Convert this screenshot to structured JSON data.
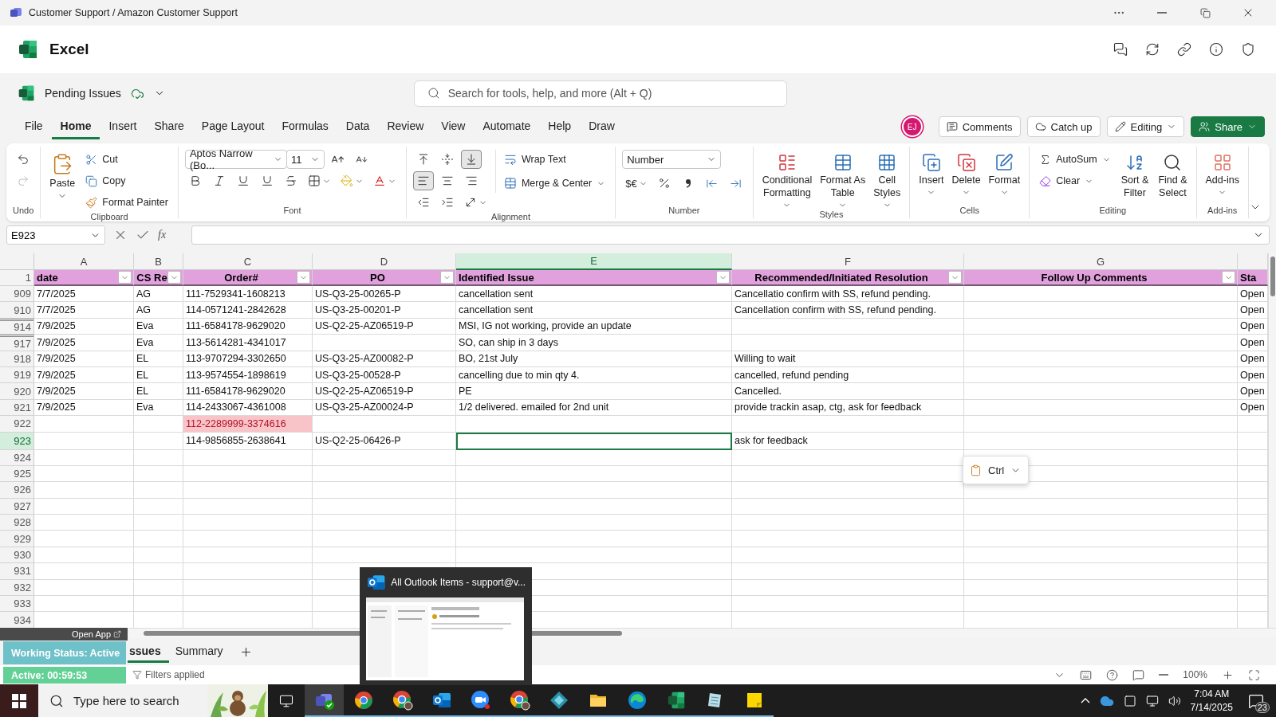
{
  "window": {
    "title": "Customer Support / Amazon Customer Support"
  },
  "app": {
    "name": "Excel"
  },
  "document": {
    "name": "Pending Issues",
    "saved": true
  },
  "search": {
    "placeholder": "Search for tools, help, and more (Alt + Q)"
  },
  "menu_tabs": [
    {
      "label": "File",
      "selected": false
    },
    {
      "label": "Home",
      "selected": true
    },
    {
      "label": "Insert",
      "selected": false
    },
    {
      "label": "Share",
      "selected": false
    },
    {
      "label": "Page Layout",
      "selected": false
    },
    {
      "label": "Formulas",
      "selected": false
    },
    {
      "label": "Data",
      "selected": false
    },
    {
      "label": "Review",
      "selected": false
    },
    {
      "label": "View",
      "selected": false
    },
    {
      "label": "Automate",
      "selected": false
    },
    {
      "label": "Help",
      "selected": false
    },
    {
      "label": "Draw",
      "selected": false
    }
  ],
  "user": {
    "initials": "EJ"
  },
  "header_buttons": [
    {
      "label": "Comments",
      "kind": "comments"
    },
    {
      "label": "Catch up",
      "kind": "catchup"
    },
    {
      "label": "Editing",
      "kind": "editing"
    },
    {
      "label": "Share",
      "kind": "share"
    }
  ],
  "ribbon": {
    "groups": [
      {
        "kind": "undo",
        "label": "Undo",
        "items": [
          {
            "disabled": false
          },
          {
            "disabled": true
          }
        ]
      },
      {
        "kind": "clipboard",
        "label": "Clipboard",
        "items": [
          {
            "label": "Paste"
          },
          {
            "label": "Cut"
          },
          {
            "label": "Copy"
          },
          {
            "label": "Format Painter"
          }
        ]
      },
      {
        "kind": "font",
        "label": "Font",
        "font_name": "Aptos Narrow (Bo...",
        "font_size": "11"
      },
      {
        "kind": "alignment",
        "label": "Alignment",
        "items": [
          {
            "selected": false
          },
          {
            "selected": false
          },
          {
            "selected": true
          },
          {
            "selected": true
          },
          {
            "selected": false
          },
          {
            "selected": false
          },
          {
            "selected": false
          },
          {
            "selected": false
          },
          {
            "selected": false
          },
          {
            "label": "Wrap Text"
          },
          {
            "label": "Merge & Center"
          }
        ]
      },
      {
        "kind": "number",
        "label": "Number",
        "format": "Number",
        "currency": "$€"
      },
      {
        "kind": "styles",
        "label": "Styles",
        "items": [
          {
            "lines": [
              "Conditional",
              "Formatting"
            ]
          },
          {
            "lines": [
              "Format As",
              "Table"
            ]
          },
          {
            "lines": [
              "Cell",
              "Styles"
            ]
          }
        ]
      },
      {
        "kind": "cells",
        "label": "Cells",
        "items": [
          {
            "lines": [
              "Insert"
            ]
          },
          {
            "lines": [
              "Delete"
            ]
          },
          {
            "lines": [
              "Format"
            ]
          }
        ]
      },
      {
        "kind": "editing",
        "label": "Editing",
        "items": [
          {
            "lines": [
              "AutoSum"
            ]
          },
          {
            "lines": [
              "Clear"
            ]
          },
          {
            "lines": [
              "Sort &",
              "Filter"
            ]
          },
          {
            "lines": [
              "Find &",
              "Select"
            ]
          }
        ]
      },
      {
        "kind": "addins",
        "label": "Add-ins",
        "items": [
          {
            "lines": [
              "Add-ins"
            ]
          }
        ]
      }
    ]
  },
  "formula_bar": {
    "name_box": "E923",
    "function_label": "fx"
  },
  "sheet": {
    "columns": [
      {
        "letter": "A",
        "header": "date",
        "filter": true,
        "selected": false
      },
      {
        "letter": "B",
        "header": "CS Re",
        "filter": true,
        "selected": false
      },
      {
        "letter": "C",
        "header": "Order#",
        "filter": true,
        "selected": false
      },
      {
        "letter": "D",
        "header": "PO",
        "filter": true,
        "selected": false
      },
      {
        "letter": "E",
        "header": "Identified Issue",
        "filter": true,
        "selected": true
      },
      {
        "letter": "F",
        "header": "Recommended/Initiated Resolution",
        "filter": true,
        "selected": false
      },
      {
        "letter": "G",
        "header": "Follow Up Comments",
        "filter": true,
        "selected": false
      },
      {
        "header": "Sta",
        "filter": false,
        "selected": false
      }
    ],
    "header_row": "1",
    "rows": [
      {
        "row": "909",
        "selected": false,
        "gap_above": false,
        "cells": [
          "7/7/2025",
          "AG",
          "111-7529341-1608213",
          "US-Q3-25-00265-P",
          "cancellation sent",
          "Cancellatio confirm with SS, refund pending.",
          null,
          "Open"
        ]
      },
      {
        "row": "910",
        "selected": false,
        "gap_above": false,
        "cells": [
          "7/7/2025",
          "AG",
          "114-0571241-2842628",
          "US-Q3-25-00201-P",
          "cancellation sent",
          "Cancellation confirm with SS, refund pending.",
          null,
          "Open"
        ]
      },
      {
        "row": "914",
        "selected": false,
        "gap_above": true,
        "cells": [
          "7/9/2025",
          "Eva",
          "111-6584178-9629020",
          "US-Q2-25-AZ06519-P",
          "MSI, IG not working, provide an update",
          null,
          null,
          "Open"
        ]
      },
      {
        "row": "917",
        "selected": false,
        "gap_above": true,
        "cells": [
          "7/9/2025",
          "Eva",
          "113-5614281-4341017",
          null,
          "SO, can ship in 3 days",
          null,
          null,
          "Open"
        ]
      },
      {
        "row": "918",
        "selected": false,
        "gap_above": false,
        "cells": [
          "7/9/2025",
          "EL",
          "113-9707294-3302650",
          "US-Q3-25-AZ00082-P",
          "BO, 21st July",
          "Willing to wait",
          null,
          "Open"
        ]
      },
      {
        "row": "919",
        "selected": false,
        "gap_above": false,
        "cells": [
          "7/9/2025",
          "EL",
          "113-9574554-1898619",
          "US-Q3-25-00528-P",
          "cancelling due to min qty 4.",
          "cancelled, refund pending",
          null,
          "Open"
        ]
      },
      {
        "row": "920",
        "selected": false,
        "gap_above": false,
        "cells": [
          "7/9/2025",
          "EL",
          "111-6584178-9629020",
          "US-Q2-25-AZ06519-P",
          "PE",
          "Cancelled.",
          null,
          "Open"
        ]
      },
      {
        "row": "921",
        "selected": false,
        "gap_above": false,
        "cells": [
          "7/9/2025",
          "Eva",
          "114-2433067-4361008",
          "US-Q3-25-AZ00024-P",
          "1/2 delivered. emailed for 2nd unit",
          "provide trackin asap, ctg, ask for feedback",
          null,
          "Open"
        ]
      },
      {
        "row": "922",
        "selected": false,
        "gap_above": false,
        "cells": [
          null,
          null,
          {
            "text": "112-2289999-3374616",
            "flagged": true
          },
          null,
          null,
          null,
          null,
          null
        ]
      },
      {
        "row": "923",
        "selected": true,
        "gap_above": false,
        "cells": [
          null,
          null,
          "114-9856855-2638641",
          "US-Q2-25-06426-P",
          null,
          "ask for feedback",
          null,
          null
        ]
      },
      {
        "row": "924",
        "selected": false,
        "gap_above": false
      },
      {
        "row": "925",
        "selected": false,
        "gap_above": false
      },
      {
        "row": "926",
        "selected": false,
        "gap_above": false
      },
      {
        "row": "927",
        "selected": false,
        "gap_above": false
      },
      {
        "row": "928",
        "selected": false,
        "gap_above": false
      },
      {
        "row": "929",
        "selected": false,
        "gap_above": false
      },
      {
        "row": "930",
        "selected": false,
        "gap_above": false
      },
      {
        "row": "931",
        "selected": false,
        "gap_above": false
      },
      {
        "row": "932",
        "selected": false,
        "gap_above": false
      },
      {
        "row": "933",
        "selected": false,
        "gap_above": false
      },
      {
        "row": "934",
        "selected": false,
        "gap_above": false
      }
    ]
  },
  "paste_options": {
    "label": "Ctrl"
  },
  "sheet_tabs": [
    {
      "label": "ssues",
      "selected": true
    },
    {
      "label": "Summary",
      "selected": false
    }
  ],
  "status_bar": {
    "filters": "Filters applied",
    "zoom": "100%"
  },
  "overlay_widget": {
    "open_app": "Open App",
    "status": "Working Status: Active",
    "timer": "Active: 00:59:53"
  },
  "taskbar_preview": {
    "title": "All Outlook Items - support@v..."
  },
  "taskbar": {
    "search_placeholder": "Type here to search",
    "apps": [
      {
        "kind": "teams",
        "active": true
      },
      {
        "kind": "chrome",
        "active": false
      },
      {
        "kind": "chrome_profile",
        "active": false
      },
      {
        "kind": "outlook",
        "active": false
      },
      {
        "kind": "zoom",
        "active": false
      },
      {
        "kind": "chrome_profile",
        "active": false
      },
      {
        "kind": "diamond",
        "active": false
      },
      {
        "kind": "explorer",
        "active": false
      },
      {
        "kind": "edge",
        "active": false
      },
      {
        "kind": "excel",
        "active": false
      },
      {
        "kind": "notes",
        "active": false
      },
      {
        "kind": "sticky",
        "active": false
      }
    ],
    "time": "7:04 AM",
    "date": "7/14/2025",
    "notifications": "23"
  }
}
